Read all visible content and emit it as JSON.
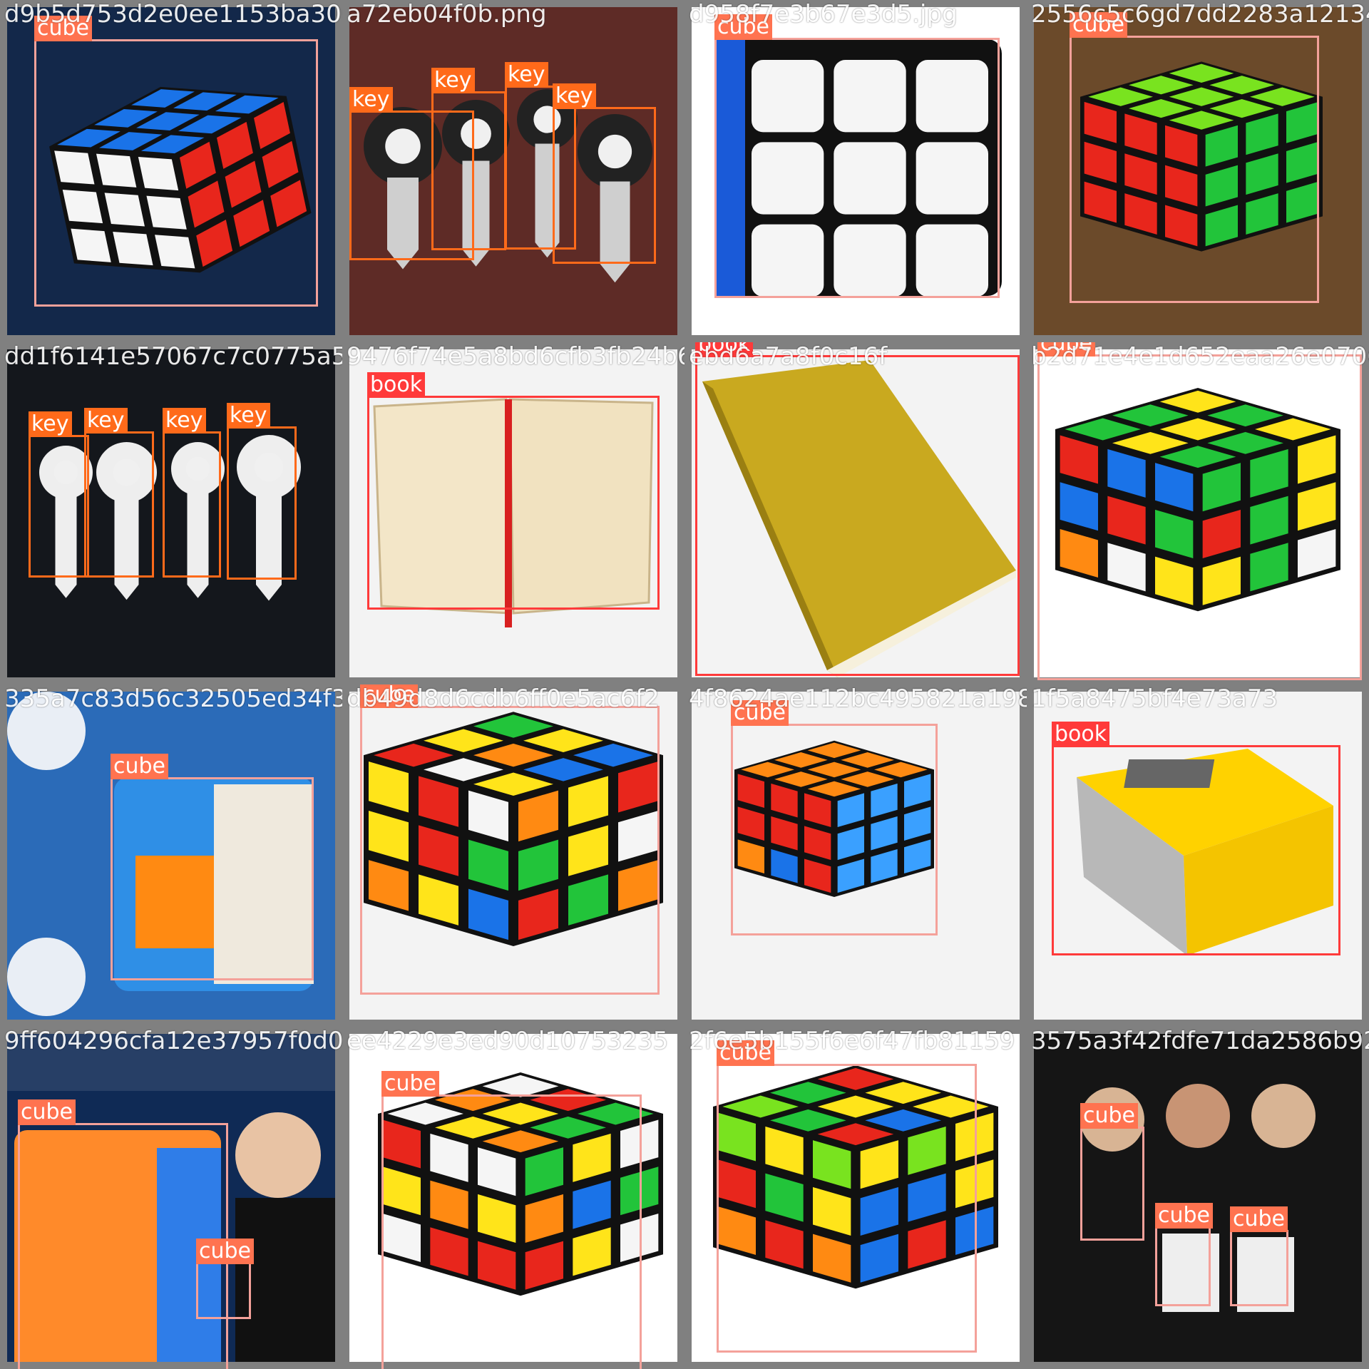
{
  "mosaic": {
    "background": "#7a7a7a",
    "class_colors": {
      "cube": "#f4a19a",
      "key": "#ff6a1a",
      "book": "#ff3a3a"
    },
    "tag_colors": {
      "cube": "#ff7350",
      "key": "#ff6a1a",
      "book": "#ff3a3a"
    },
    "tiles": [
      {
        "filename": "d9b5d753d2e0ee1153ba300d",
        "scene": "cube-blue-white",
        "boxes": [
          {
            "label": "cube"
          }
        ]
      },
      {
        "filename": "a72eb04f0b.png",
        "scene": "keys-car",
        "boxes": [
          {
            "label": "key"
          },
          {
            "label": "key"
          },
          {
            "label": "key"
          },
          {
            "label": "key"
          }
        ]
      },
      {
        "filename": "d958f7e3b67e3d5.jpg",
        "scene": "cube-white-face",
        "boxes": [
          {
            "label": "cube"
          }
        ]
      },
      {
        "filename": "2556c5c6gd7dd2283a12134e",
        "scene": "cube-green",
        "boxes": [
          {
            "label": "cube"
          }
        ]
      },
      {
        "filename": "dd1f6141e57067c7c0775a5a",
        "scene": "keys-house",
        "boxes": [
          {
            "label": "key"
          },
          {
            "label": "key"
          },
          {
            "label": "key"
          },
          {
            "label": "key"
          }
        ]
      },
      {
        "filename": "9476f74e5a8bd6cfb3fb24b6",
        "scene": "book-open",
        "boxes": [
          {
            "label": "book"
          }
        ]
      },
      {
        "filename": "ebd6a7a8f0c16f",
        "scene": "book-gold",
        "boxes": [
          {
            "label": "book"
          }
        ]
      },
      {
        "filename": "b2d71e4e1d652eaa26e0706",
        "scene": "cube-scrambled",
        "boxes": [
          {
            "label": "cube"
          }
        ]
      },
      {
        "filename": "335a7c83d56c32505ed34f3b",
        "scene": "cube-blue-promo",
        "boxes": [
          {
            "label": "cube"
          }
        ]
      },
      {
        "filename": "db49d8d6cdb6ff0e5ac6f2",
        "scene": "cube-classic",
        "boxes": [
          {
            "label": "cube"
          }
        ]
      },
      {
        "filename": "4f8624ae112bc495821a1982",
        "scene": "cube-twisted",
        "boxes": [
          {
            "label": "cube"
          }
        ]
      },
      {
        "filename": "1f5a8475bf4e73a73",
        "scene": "book-yellow",
        "boxes": [
          {
            "label": "book"
          }
        ]
      },
      {
        "filename": "9ff604296cfa12e37957f0d01",
        "scene": "cube-promo-person",
        "boxes": [
          {
            "label": "cube"
          },
          {
            "label": "cube"
          }
        ]
      },
      {
        "filename": "ee4229e3ed90d10753235",
        "scene": "cube-gan",
        "boxes": [
          {
            "label": "cube"
          }
        ]
      },
      {
        "filename": "2f6e5b155f6e6f47fb81159",
        "scene": "cube-bright",
        "boxes": [
          {
            "label": "cube"
          }
        ]
      },
      {
        "filename": "3575a3f42fdfe71da2586b922",
        "scene": "gan-poster",
        "boxes": [
          {
            "label": "cube"
          },
          {
            "label": "cube"
          },
          {
            "label": "cube"
          }
        ]
      }
    ]
  }
}
